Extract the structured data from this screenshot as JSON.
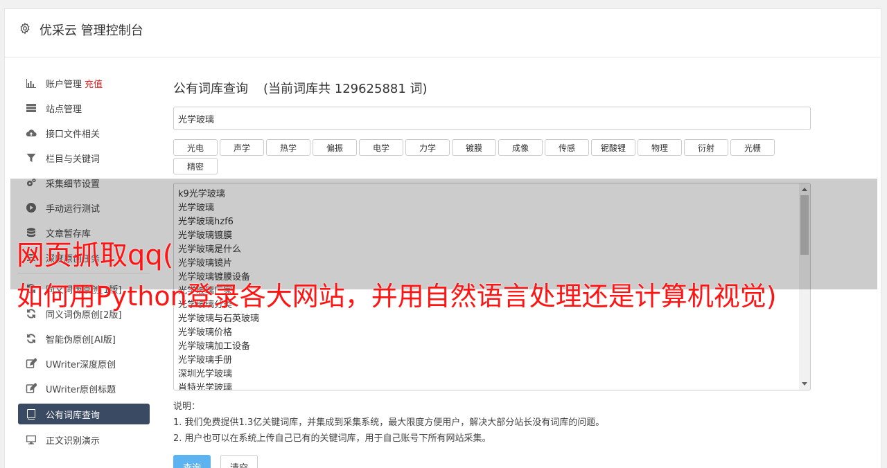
{
  "header": {
    "title": "优采云 管理控制台",
    "icon": "gear-icon"
  },
  "sidebar": {
    "items": [
      {
        "label": "账户管理",
        "badge": "充值",
        "icon": "bar-chart-icon"
      },
      {
        "label": "站点管理",
        "icon": "server-icon"
      },
      {
        "label": "接口文件相关",
        "icon": "cloud-upload-icon"
      },
      {
        "label": "栏目与关键词",
        "icon": "filter-icon"
      },
      {
        "label": "采集细节设置",
        "icon": "cogs-icon"
      },
      {
        "label": "手动运行测试",
        "icon": "play-icon"
      },
      {
        "label": "文章暂存库",
        "icon": "database-icon"
      },
      {
        "label": "深度原创任务",
        "icon": "tasks-icon"
      },
      {
        "label": "同义词伪原创[1版]",
        "icon": "refresh-icon"
      },
      {
        "label": "同义词伪原创[2版]",
        "icon": "refresh-icon"
      },
      {
        "label": "智能伪原创[AI版]",
        "icon": "refresh-icon"
      },
      {
        "label": "UWriter深度原创",
        "icon": "edit-icon"
      },
      {
        "label": "UWriter原创标题",
        "icon": "edit-icon"
      },
      {
        "label": "公有词库查询",
        "icon": "book-icon",
        "active": true
      },
      {
        "label": "正文识别演示",
        "icon": "monitor-icon"
      }
    ]
  },
  "main": {
    "title": "公有词库查询",
    "count_text": "(当前词库共 129625881 词)",
    "search_value": "光学玻璃",
    "tags": [
      "光电",
      "声学",
      "热学",
      "偏振",
      "电学",
      "力学",
      "镀膜",
      "成像",
      "传感",
      "铌酸锂",
      "物理",
      "衍射",
      "光栅",
      "精密"
    ],
    "results": [
      "k9光学玻璃",
      "光学玻璃",
      "光学玻璃hzf6",
      "光学玻璃镀膜",
      "光学玻璃是什么",
      "光学玻璃镜片",
      "光学玻璃镀膜设备",
      "光学玻璃厂家",
      "光学玻璃分类",
      "光学玻璃与石英玻璃",
      "光学玻璃价格",
      "光学玻璃加工设备",
      "光学玻璃手册",
      "深圳光学玻璃",
      "肖特光学玻璃"
    ],
    "notes_title": "说明：",
    "notes": [
      "1. 我们免费提供1.3亿关键词库，并集成到采集系统，最大限度方便用户，解决大部分站长没有词库的问题。",
      "2. 用户也可以在系统上传自己已有的关键词库，用于自己账号下所有网站采集。"
    ],
    "query_label": "查询",
    "clear_label": "清空"
  },
  "overlay": {
    "line1": "网页抓取qq(",
    "line2": "如何用Python登录各大网站，并用自然语言处理还是计算机视觉)"
  },
  "colors": {
    "accent": "#5cb3f0",
    "active_nav": "#3b4a63",
    "badge": "#e02020",
    "overlay_text": "#ff1414"
  }
}
